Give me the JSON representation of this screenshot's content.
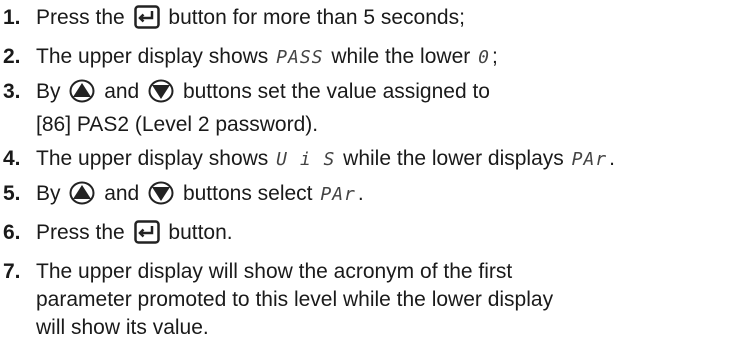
{
  "steps": [
    {
      "num": "1.",
      "a": "Press the",
      "b": "button for more than 5 seconds;"
    },
    {
      "num": "2.",
      "a": "The upper display shows",
      "seg1": "PASS",
      "b": "while the lower",
      "seg2": "0",
      "c": ";"
    },
    {
      "num": "3.",
      "a": "By",
      "b": "and",
      "c": "buttons set the value assigned to",
      "line2": "[86] PAS2 (Level 2 password)."
    },
    {
      "num": "4.",
      "a": "The upper display shows",
      "seg1": "U i S",
      "b": "while the lower displays",
      "seg2": "PAr",
      "c": "."
    },
    {
      "num": "5.",
      "a": "By",
      "b": "and",
      "c": "buttons select",
      "seg1": "PAr",
      "d": "."
    },
    {
      "num": "6.",
      "a": "Press the",
      "b": "button."
    },
    {
      "num": "7.",
      "a": "The upper display will show the acronym of the first",
      "line2": "parameter promoted to this level while the lower display",
      "line3": "will show its value."
    }
  ],
  "icons": {
    "enter": "enter-key-icon",
    "up": "up-arrow-button-icon",
    "down": "down-arrow-button-icon"
  }
}
